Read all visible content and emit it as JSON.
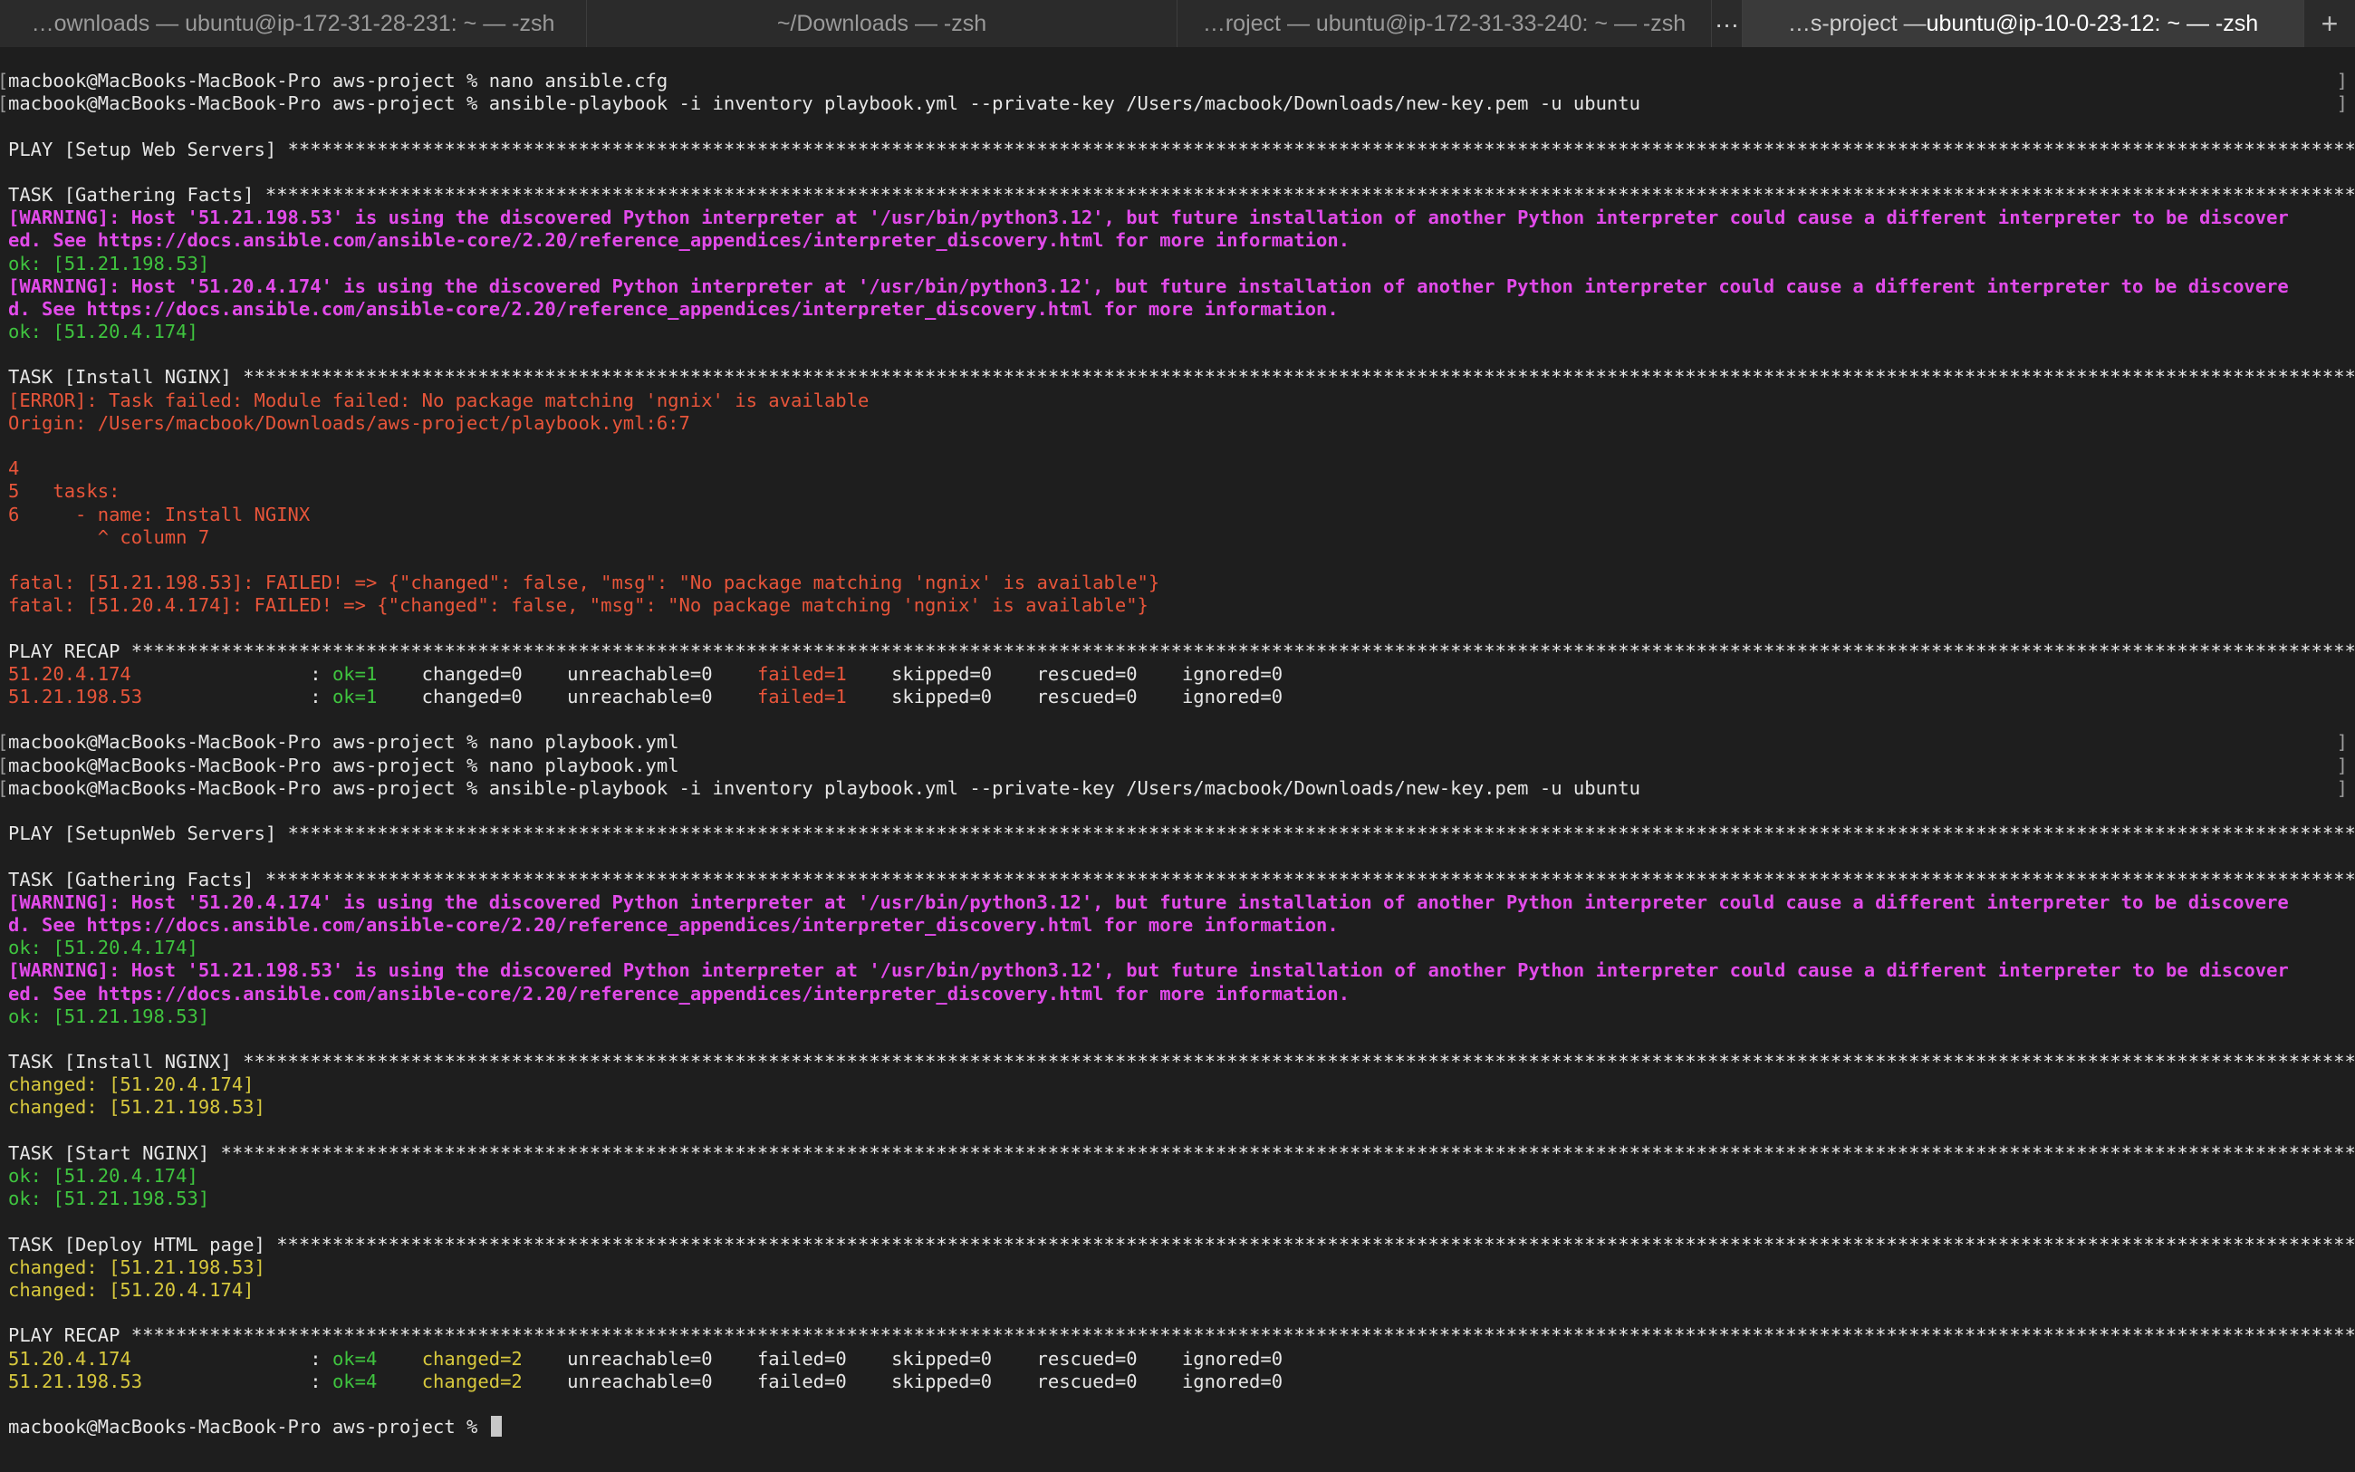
{
  "tabs": [
    {
      "label": "…ownloads — ubuntu@ip-172-31-28-231: ~ — -zsh"
    },
    {
      "label": "~/Downloads — -zsh"
    },
    {
      "label": "…roject — ubuntu@ip-172-31-33-240: ~ — -zsh"
    },
    {
      "label_prefix": "…s-project — ",
      "label_main": "ubuntu@ip-10-0-23-12: ~ — -zsh"
    }
  ],
  "more_tabs": "…",
  "new_tab": "+",
  "terminal": {
    "prompt": "macbook@MacBooks-MacBook-Pro aws-project % ",
    "cmd1": "nano ansible.cfg",
    "cmd2": "ansible-playbook -i inventory playbook.yml --private-key /Users/macbook/Downloads/new-key.pem -u ubuntu",
    "play1": "PLAY [Setup Web Servers] ",
    "task_gather": "TASK [Gathering Facts] ",
    "warn1a": "[WARNING]: Host '51.21.198.53' is using the discovered Python interpreter at '/usr/bin/python3.12', but future installation of another Python interpreter could cause a different interpreter to be discover",
    "warn1b": "ed. See https://docs.ansible.com/ansible-core/2.20/reference_appendices/interpreter_discovery.html for more information.",
    "ok1": "ok: [51.21.198.53]",
    "warn2a": "[WARNING]: Host '51.20.4.174' is using the discovered Python interpreter at '/usr/bin/python3.12', but future installation of another Python interpreter could cause a different interpreter to be discovere",
    "warn2b": "d. See https://docs.ansible.com/ansible-core/2.20/reference_appendices/interpreter_discovery.html for more information.",
    "ok2": "ok: [51.20.4.174]",
    "task_install": "TASK [Install NGINX] ",
    "error1": "[ERROR]: Task failed: Module failed: No package matching 'ngnix' is available",
    "origin": "Origin: /Users/macbook/Downloads/aws-project/playbook.yml:6:7",
    "src4": "4",
    "src5": "5   tasks:",
    "src6": "6     - name: Install NGINX",
    "src_caret": "        ^ column 7",
    "fatal1": "fatal: [51.21.198.53]: FAILED! => {\"changed\": false, \"msg\": \"No package matching 'ngnix' is available\"}",
    "fatal2": "fatal: [51.20.4.174]: FAILED! => {\"changed\": false, \"msg\": \"No package matching 'ngnix' is available\"}",
    "recap": "PLAY RECAP ",
    "recap1": {
      "host1": "51.20.4.174                ",
      "ok1": "ok=1",
      "rest1a": "    changed=0    unreachable=0    ",
      "failed1": "failed=1",
      "rest1b": "    skipped=0    rescued=0    ignored=0",
      "host2": "51.21.198.53               ",
      "ok2": "ok=1",
      "rest2a": "    changed=0    unreachable=0    ",
      "failed2": "failed=1",
      "rest2b": "    skipped=0    rescued=0    ignored=0"
    },
    "colon": ": ",
    "cmd3": "nano playbook.yml",
    "cmd4": "nano playbook.yml",
    "cmd5": "ansible-playbook -i inventory playbook.yml --private-key /Users/macbook/Downloads/new-key.pem -u ubuntu",
    "play2": "PLAY [SetupnWeb Servers] ",
    "warn3a": "[WARNING]: Host '51.20.4.174' is using the discovered Python interpreter at '/usr/bin/python3.12', but future installation of another Python interpreter could cause a different interpreter to be discovere",
    "warn3b": "d. See https://docs.ansible.com/ansible-core/2.20/reference_appendices/interpreter_discovery.html for more information.",
    "ok3": "ok: [51.20.4.174]",
    "warn4a": "[WARNING]: Host '51.21.198.53' is using the discovered Python interpreter at '/usr/bin/python3.12', but future installation of another Python interpreter could cause a different interpreter to be discover",
    "warn4b": "ed. See https://docs.ansible.com/ansible-core/2.20/reference_appendices/interpreter_discovery.html for more information.",
    "ok4": "ok: [51.21.198.53]",
    "changed1": "changed: [51.20.4.174]",
    "changed2": "changed: [51.21.198.53]",
    "task_start": "TASK [Start NGINX] ",
    "ok5": "ok: [51.20.4.174]",
    "ok6": "ok: [51.21.198.53]",
    "task_deploy": "TASK [Deploy HTML page] ",
    "changed3": "changed: [51.21.198.53]",
    "changed4": "changed: [51.20.4.174]",
    "recap2": {
      "host1": "51.20.4.174                ",
      "ok1": "ok=4",
      "changed1": "changed=2",
      "rest1": "    unreachable=0    failed=0    skipped=0    rescued=0    ignored=0",
      "host2": "51.21.198.53               ",
      "ok2": "ok=4",
      "changed2": "changed=2",
      "rest2": "    unreachable=0    failed=0    skipped=0    rescued=0    ignored=0"
    },
    "final_prompt": "macbook@MacBooks-MacBook-Pro aws-project % "
  },
  "colors": {
    "background": "#1e1e1e",
    "warning": "#e24bea",
    "ok": "#3fc43f",
    "changed": "#d7c83d",
    "error": "#e8553a"
  }
}
